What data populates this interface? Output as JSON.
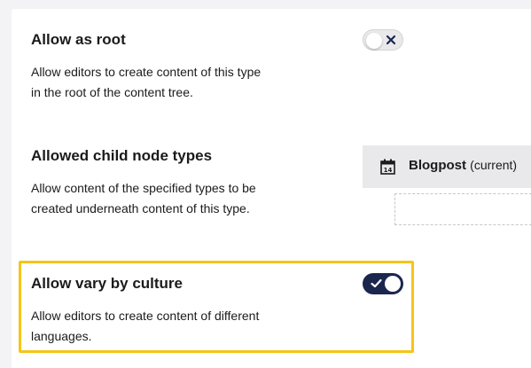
{
  "settings": {
    "allow_root": {
      "title": "Allow as root",
      "description_line1": "Allow editors to create content of this type",
      "description_line2": "in the root of the content tree.",
      "enabled": false
    },
    "allowed_child": {
      "title": "Allowed child node types",
      "description_line1": "Allow content of the specified types to be",
      "description_line2": "created underneath content of this type.",
      "node_name": "Blogpost",
      "node_suffix": "(current)",
      "node_icon": "calendar-icon",
      "calendar_day": "14"
    },
    "vary_culture": {
      "title": "Allow vary by culture",
      "description_line1": "Allow editors to create content of different",
      "description_line2": "languages.",
      "enabled": true
    }
  },
  "colors": {
    "toggle_on": "#1b264f",
    "highlight": "#f5c518",
    "panel": "#ffffff",
    "background": "#f3f3f5"
  }
}
